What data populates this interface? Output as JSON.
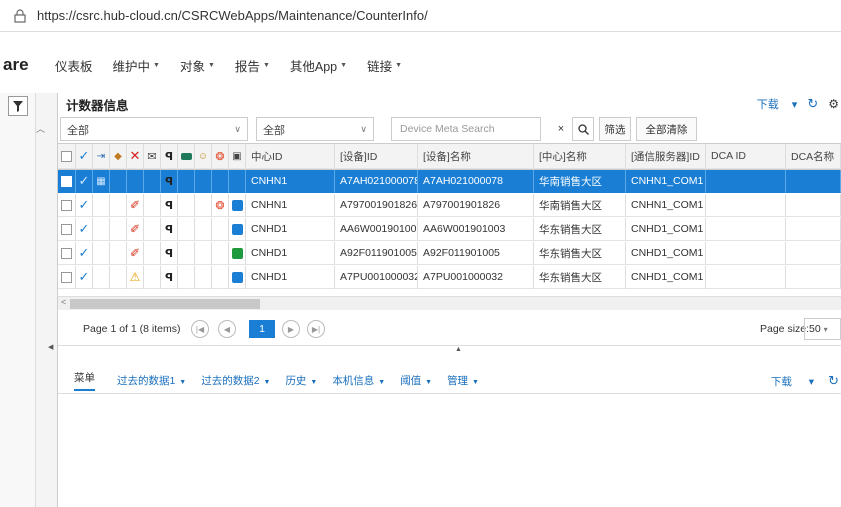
{
  "browser": {
    "url": "https://csrc.hub-cloud.cn/CSRCWebApps/Maintenance/CounterInfo/"
  },
  "nav": {
    "brand": "are",
    "items": [
      {
        "label": "仪表板",
        "caret": false
      },
      {
        "label": "维护中",
        "caret": true
      },
      {
        "label": "对象",
        "caret": true
      },
      {
        "label": "报告",
        "caret": true
      },
      {
        "label": "其他App",
        "caret": true
      },
      {
        "label": "链接",
        "caret": true
      }
    ]
  },
  "panel": {
    "title": "计数器信息",
    "download_label": "下载"
  },
  "filters": {
    "select1": "全部",
    "select2": "全部",
    "search_placeholder": "Device Meta Search",
    "clear_glyph": "×",
    "filter_button": "筛选",
    "clear_all_button": "全部清除"
  },
  "grid": {
    "columns": [
      "中心ID",
      "[设备]ID",
      "[设备]名称",
      "[中心]名称",
      "[通信服务器]ID",
      "DCA ID",
      "DCA名称"
    ],
    "rows": [
      {
        "selected": true,
        "icons": [
          "check",
          "grid",
          "",
          "",
          "",
          "bino",
          "",
          "",
          "",
          ""
        ],
        "center_id": "CNHN1",
        "device_id": "A7AH021000078",
        "device_name": "A7AH021000078",
        "center_name": "华南销售大区",
        "comm_server_id": "CNHN1_COM1",
        "dca_id": "",
        "dca_name": ""
      },
      {
        "selected": false,
        "icons": [
          "check",
          "",
          "",
          "wrench",
          "",
          "bino",
          "",
          "",
          "ball",
          "bluesq"
        ],
        "center_id": "CNHN1",
        "device_id": "A797001901826",
        "device_name": "A797001901826",
        "center_name": "华南销售大区",
        "comm_server_id": "CNHN1_COM1",
        "dca_id": "",
        "dca_name": ""
      },
      {
        "selected": false,
        "icons": [
          "check",
          "",
          "",
          "wrench",
          "",
          "bino",
          "",
          "",
          "",
          "bluesq"
        ],
        "center_id": "CNHD1",
        "device_id": "AA6W001901003",
        "device_name": "AA6W001901003",
        "center_name": "华东销售大区",
        "comm_server_id": "CNHD1_COM1",
        "dca_id": "",
        "dca_name": ""
      },
      {
        "selected": false,
        "icons": [
          "check",
          "",
          "",
          "wrench",
          "",
          "bino",
          "",
          "",
          "",
          "greensq"
        ],
        "center_id": "CNHD1",
        "device_id": "A92F011901005",
        "device_name": "A92F011901005",
        "center_name": "华东销售大区",
        "comm_server_id": "CNHD1_COM1",
        "dca_id": "",
        "dca_name": ""
      },
      {
        "selected": false,
        "icons": [
          "check",
          "",
          "",
          "warn",
          "",
          "bino",
          "",
          "",
          "",
          "bluesq"
        ],
        "center_id": "CNHD1",
        "device_id": "A7PU001000032",
        "device_name": "A7PU001000032",
        "center_name": "华东销售大区",
        "comm_server_id": "CNHD1_COM1",
        "dca_id": "",
        "dca_name": ""
      }
    ]
  },
  "pager": {
    "info": "Page 1 of 1 (8 items)",
    "current_page": "1",
    "page_size_label": "Page size:",
    "page_size": "50"
  },
  "bottom_tabs": {
    "items": [
      {
        "label": "菜单",
        "caret": false
      },
      {
        "label": "过去的数据1",
        "caret": true
      },
      {
        "label": "过去的数据2",
        "caret": true
      },
      {
        "label": "历史",
        "caret": true
      },
      {
        "label": "本机信息",
        "caret": true
      },
      {
        "label": "阈值",
        "caret": true
      },
      {
        "label": "管理",
        "caret": true
      }
    ],
    "download_label": "下载"
  },
  "colors": {
    "accent": "#1a7fd4",
    "green_square": "#1e9a3c",
    "blue_square": "#1a7fd4"
  }
}
